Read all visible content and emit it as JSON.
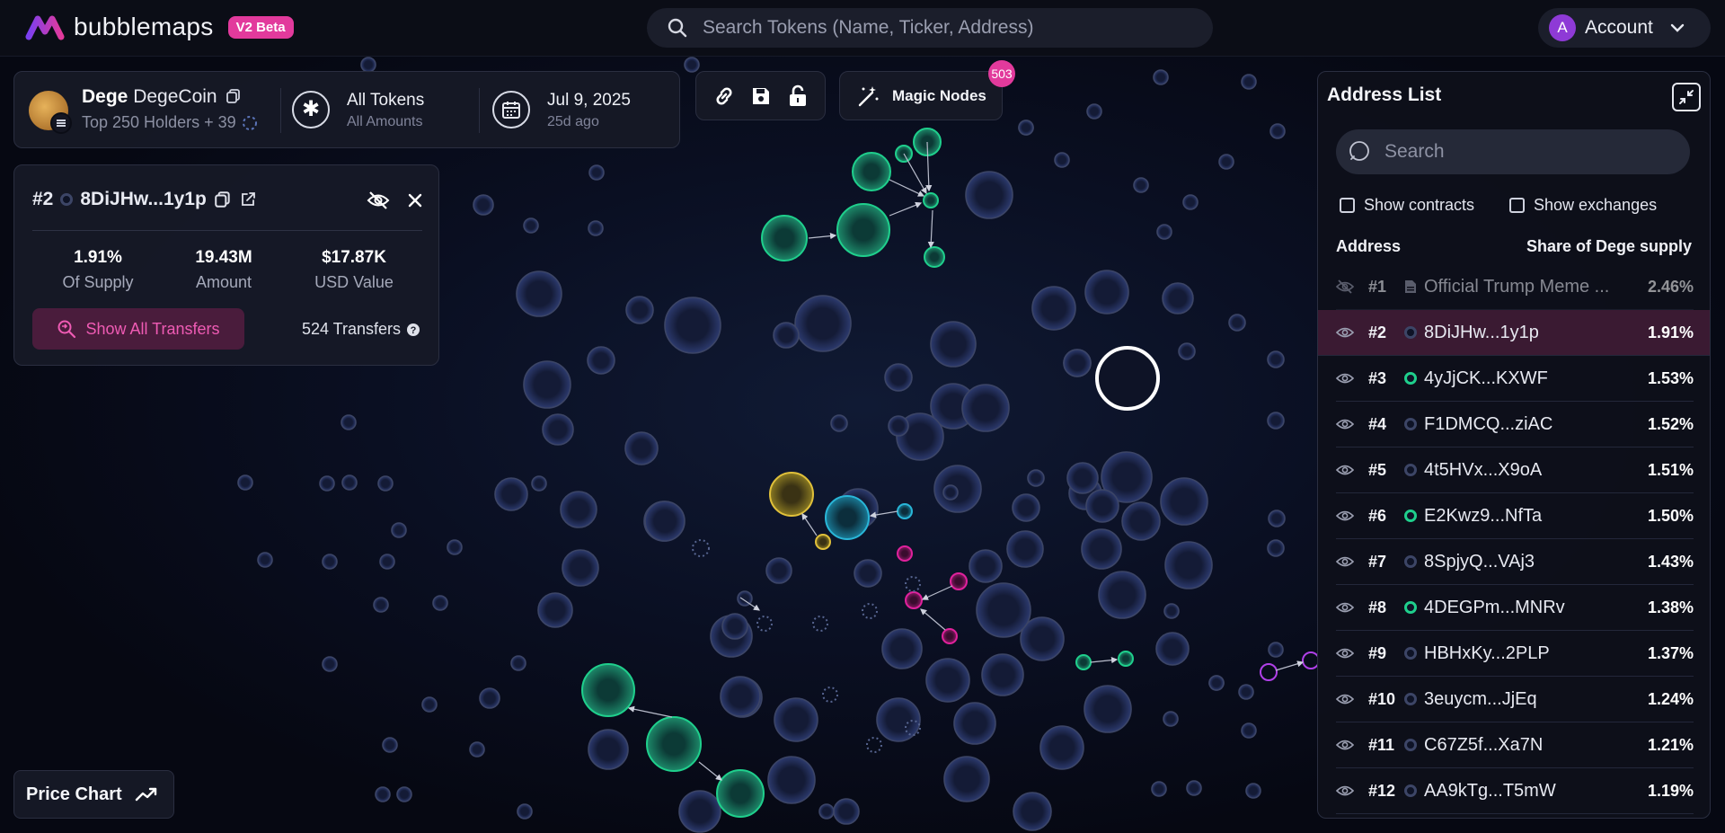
{
  "header": {
    "brand": "bubblemaps",
    "badge": "V2 Beta",
    "search_placeholder": "Search Tokens (Name, Ticker, Address)",
    "account_initial": "A",
    "account_label": "Account"
  },
  "token": {
    "ticker": "Dege",
    "name": "DegeCoin",
    "holders": "Top 250 Holders + 39",
    "filter_main": "All Tokens",
    "filter_sub": "All Amounts",
    "date_main": "Jul 9, 2025",
    "date_sub": "25d ago"
  },
  "toolbar": {
    "magic_label": "Magic Nodes",
    "magic_count": "503"
  },
  "address_card": {
    "rank": "#2",
    "address": "8DiJHw...1y1p",
    "supply_value": "1.91%",
    "supply_label": "Of Supply",
    "amount_value": "19.43M",
    "amount_label": "Amount",
    "usd_value": "$17.87K",
    "usd_label": "USD Value",
    "transfers_button": "Show All Transfers",
    "transfers_count": "524 Transfers"
  },
  "price_chart_label": "Price Chart",
  "address_list": {
    "title": "Address List",
    "search_placeholder": "Search",
    "show_contracts": "Show contracts",
    "show_exchanges": "Show exchanges",
    "col_address": "Address",
    "col_share": "Share of Dege supply",
    "rows": [
      {
        "rank": "#1",
        "name": "Official Trump Meme ...",
        "pct": "2.46%",
        "kind": "contract",
        "hidden": true
      },
      {
        "rank": "#2",
        "name": "8DiJHw...1y1p",
        "pct": "1.91%",
        "kind": "ring",
        "selected": true
      },
      {
        "rank": "#3",
        "name": "4yJjCK...KXWF",
        "pct": "1.53%",
        "kind": "green"
      },
      {
        "rank": "#4",
        "name": "F1DMCQ...ziAC",
        "pct": "1.52%",
        "kind": "ring"
      },
      {
        "rank": "#5",
        "name": "4t5HVx...X9oA",
        "pct": "1.51%",
        "kind": "ring"
      },
      {
        "rank": "#6",
        "name": "E2Kwz9...NfTa",
        "pct": "1.50%",
        "kind": "green"
      },
      {
        "rank": "#7",
        "name": "8SpjyQ...VAj3",
        "pct": "1.43%",
        "kind": "ring"
      },
      {
        "rank": "#8",
        "name": "4DEGPm...MNRv",
        "pct": "1.38%",
        "kind": "green"
      },
      {
        "rank": "#9",
        "name": "HBHxKy...2PLP",
        "pct": "1.37%",
        "kind": "ring"
      },
      {
        "rank": "#10",
        "name": "3euycm...JjEq",
        "pct": "1.24%",
        "kind": "ring"
      },
      {
        "rank": "#11",
        "name": "C67Z5f...Xa7N",
        "pct": "1.21%",
        "kind": "ring"
      },
      {
        "rank": "#12",
        "name": "AA9kTg...T5mW",
        "pct": "1.19%",
        "kind": "ring"
      }
    ]
  },
  "colors": {
    "accent": "#e23a9c",
    "green": "#1fcf8c",
    "yellow": "#e0c03a",
    "cyan": "#29b6d8",
    "magenta": "#e0219c",
    "purple": "#b040e8",
    "bubble": "#3c4566"
  },
  "icons": {
    "search": "search-icon",
    "copy": "copy-icon",
    "refresh": "refresh-icon",
    "hide": "eye-off-icon",
    "close": "close-icon",
    "link": "link-icon",
    "save": "save-icon",
    "lock": "lock-icon",
    "magic": "magic-wand-icon",
    "chart": "trend-icon",
    "calendar": "calendar-icon",
    "asterisk": "asterisk-icon",
    "eye": "eye-icon"
  }
}
